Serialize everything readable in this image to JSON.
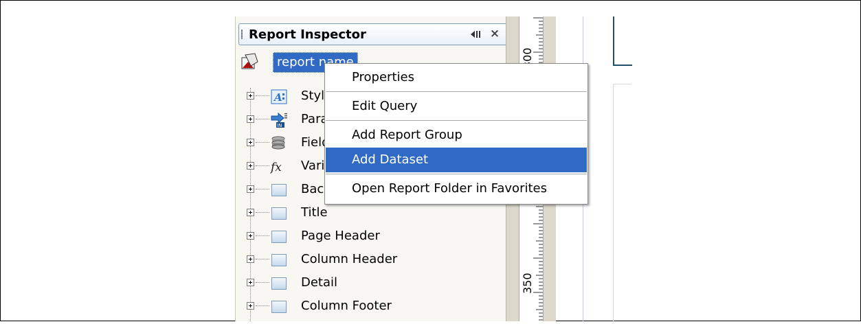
{
  "inspector": {
    "title": "Report Inspector",
    "root_label": "report name",
    "nodes": [
      {
        "label": "Styles",
        "icon": "styles-icon"
      },
      {
        "label": "Parameters",
        "icon": "parameters-icon"
      },
      {
        "label": "Fields",
        "icon": "fields-icon"
      },
      {
        "label": "Variables",
        "icon": "variables-icon"
      },
      {
        "label": "Background",
        "icon": "band-icon"
      },
      {
        "label": "Title",
        "icon": "band-icon"
      },
      {
        "label": "Page Header",
        "icon": "band-icon"
      },
      {
        "label": "Column Header",
        "icon": "band-icon"
      },
      {
        "label": "Detail",
        "icon": "band-icon"
      },
      {
        "label": "Column Footer",
        "icon": "band-icon"
      }
    ]
  },
  "ruler": {
    "labels": [
      "300",
      "350"
    ]
  },
  "context_menu": {
    "items": [
      {
        "label": "Properties"
      },
      {
        "label": "Edit Query"
      },
      {
        "label": "Add Report Group"
      },
      {
        "label": "Add Dataset"
      },
      {
        "label": "Open Report Folder in Favorites"
      }
    ],
    "active_item": "Add Dataset"
  },
  "colors": {
    "selection": "#316ac5",
    "panel": "#f8f7f2",
    "ruler": "#dcd9cc"
  }
}
